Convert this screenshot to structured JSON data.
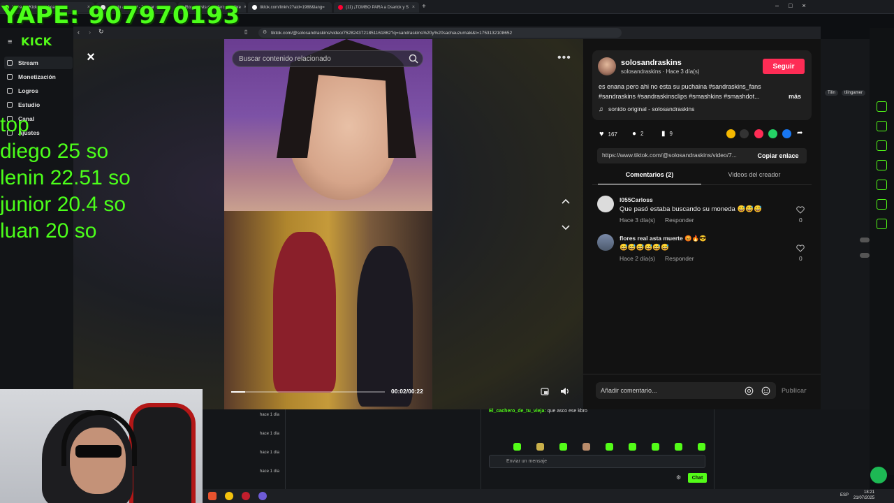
{
  "overlay": {
    "yape": "YAPE: 907970193",
    "top_list": [
      "top",
      "diego 25 so",
      "lenin 22.51 so",
      "junior 20.4 so",
      "luan 20 so"
    ]
  },
  "outer_tabs": [
    {
      "label": "Stream - Kick Dashboard"
    },
    {
      "label": "nagato akatsuki - Buscar con G"
    },
    {
      "label": "Ropa Akatsuki | MercadoLibre"
    },
    {
      "label": "tiktok.com/link/v2?aid=1988&lang="
    },
    {
      "label": "(11) ¡TOMBO PARA a Dsarick y S"
    }
  ],
  "kick": {
    "logo": "KICK",
    "nav": [
      {
        "label": "Stream"
      },
      {
        "label": "Monetización"
      },
      {
        "label": "Logros"
      },
      {
        "label": "Estudio"
      },
      {
        "label": "Canal"
      },
      {
        "label": "Ajustes"
      }
    ]
  },
  "browser": {
    "url": "tiktok.com/@solosandraskins/video/7528243721851161862?q=sandraskins%20y%20sachauzumaki&t=1753132108652"
  },
  "video": {
    "search_placeholder": "Buscar contenido relacionado",
    "time": "00:02/00:22",
    "progress": 0.09
  },
  "author": {
    "name": "solosandraskins",
    "sub": "solosandraskins · Hace 3 día(s)",
    "follow": "Seguir",
    "caption_line1": "es enana pero ahi no esta su puchaina #sandraskins_fans",
    "caption_line2": "#sandraskins #sandraskinsclips #smashkins #smashdot...",
    "more": "más",
    "sound": "sonido original - solosandraskins"
  },
  "stats": {
    "likes": "167",
    "comments": "2",
    "saves": "9"
  },
  "link": {
    "url": "https://www.tiktok.com/@solosandraskins/video/7...",
    "copy": "Copiar enlace"
  },
  "tabs": {
    "comments": "Comentarios (2)",
    "creator": "Videos del creador"
  },
  "comments": [
    {
      "user": "l055Carloss",
      "text": "Que pasó estaba buscando su moneda 😅😅😅",
      "meta": "Hace 3 día(s)",
      "reply": "Responder",
      "likes": "0"
    },
    {
      "user": "flores real asta muerte 😡🔥😎",
      "text": "😅😅😅😅😅😅",
      "meta": "Hace 2 día(s)",
      "reply": "Responder",
      "likes": "0"
    }
  ],
  "comment_input": {
    "placeholder": "Añadir comentario...",
    "publish": "Publicar"
  },
  "right_dash": {
    "tag1": "Tilin",
    "tag2": "tilingamer"
  },
  "bottom": {
    "times": [
      "hace 1 día",
      "hace 1 día",
      "hace 1 día",
      "hace 1 día"
    ],
    "chat_user": "El_cachero_de_tu_vieja:",
    "chat_msg": " que asco ese kbro",
    "chat_placeholder": "Enviar un mensaje",
    "chat_button": "Chat"
  },
  "taskbar": {
    "lang": "ESP",
    "time": "18:21",
    "date": "21/07/2025"
  },
  "colors": {
    "kick_green": "#53fc18",
    "tiktok_red": "#fe2c55",
    "overlay_green": "#4cff1a"
  }
}
